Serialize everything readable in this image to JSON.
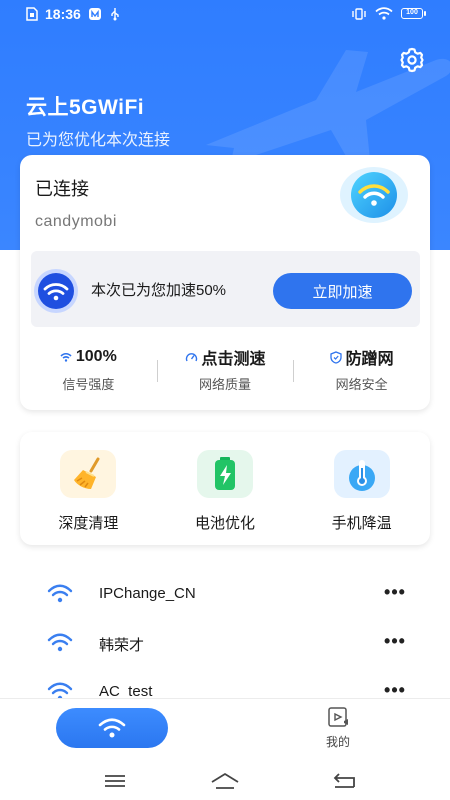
{
  "status_bar": {
    "time": "18:36",
    "battery": "100"
  },
  "header": {
    "title": "云上5GWiFi",
    "subtitle": "已为您优化本次连接"
  },
  "connection": {
    "status": "已连接",
    "ssid": "candymobi",
    "boost_text": "本次已为您加速50%",
    "boost_button": "立即加速",
    "boost_percent": 50
  },
  "stats": [
    {
      "value": "100%",
      "label": "信号强度",
      "icon": "wifi-small-icon"
    },
    {
      "value": "点击测速",
      "label": "网络质量",
      "icon": "speedometer-icon"
    },
    {
      "value": "防蹭网",
      "label": "网络安全",
      "icon": "shield-icon"
    }
  ],
  "tools": [
    {
      "label": "深度清理",
      "icon": "broom-icon"
    },
    {
      "label": "电池优化",
      "icon": "battery-charge-icon"
    },
    {
      "label": "手机降温",
      "icon": "thermometer-icon"
    }
  ],
  "wifi_list": [
    {
      "ssid": "IPChange_CN"
    },
    {
      "ssid": "韩荣才"
    },
    {
      "ssid": "AC_test"
    }
  ],
  "bottom_nav": {
    "mine_label": "我的"
  },
  "colors": {
    "primary": "#2f7dff",
    "button": "#2f74ee",
    "wifi_icon": "#3a7ff0"
  }
}
